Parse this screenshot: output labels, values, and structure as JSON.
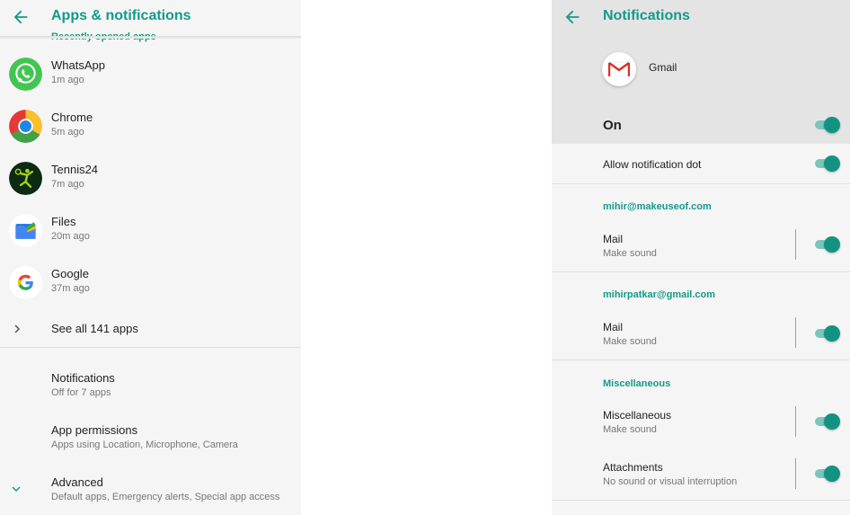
{
  "left": {
    "title": "Apps & notifications",
    "section_header": "Recently opened apps",
    "recent_apps": [
      {
        "name": "WhatsApp",
        "time": "1m ago"
      },
      {
        "name": "Chrome",
        "time": "5m ago"
      },
      {
        "name": "Tennis24",
        "time": "7m ago"
      },
      {
        "name": "Files",
        "time": "20m ago"
      },
      {
        "name": "Google",
        "time": "37m ago"
      }
    ],
    "see_all": "See all 141 apps",
    "items": [
      {
        "title": "Notifications",
        "subtitle": "Off for 7 apps"
      },
      {
        "title": "App permissions",
        "subtitle": "Apps using Location, Microphone, Camera"
      },
      {
        "title": "Advanced",
        "subtitle": "Default apps, Emergency alerts, Special app access"
      }
    ]
  },
  "right": {
    "title": "Notifications",
    "app_name": "Gmail",
    "on_label": "On",
    "on_state": true,
    "allow_dot_label": "Allow notification dot",
    "allow_dot_state": true,
    "accounts": [
      {
        "header": "mihir@makeuseof.com",
        "channel": "Mail",
        "subtitle": "Make sound",
        "state": true
      },
      {
        "header": "mihirpatkar@gmail.com",
        "channel": "Mail",
        "subtitle": "Make sound",
        "state": true
      }
    ],
    "misc_header": "Miscellaneous",
    "misc_channels": [
      {
        "label": "Miscellaneous",
        "subtitle": "Make sound",
        "state": true
      },
      {
        "label": "Attachments",
        "subtitle": "No sound or visual interruption",
        "state": true
      }
    ]
  },
  "colors": {
    "accent": "#139a89",
    "toggle_on_knob": "#129382",
    "toggle_on_track": "#7bc6bc",
    "panel_background": "#f5f5f5",
    "on_band": "#e4e4e4"
  },
  "icons": [
    "back-arrow-icon",
    "whatsapp-icon",
    "chrome-icon",
    "tennis24-icon",
    "files-icon",
    "google-icon",
    "chevron-right-icon",
    "chevron-down-icon",
    "gmail-icon"
  ]
}
